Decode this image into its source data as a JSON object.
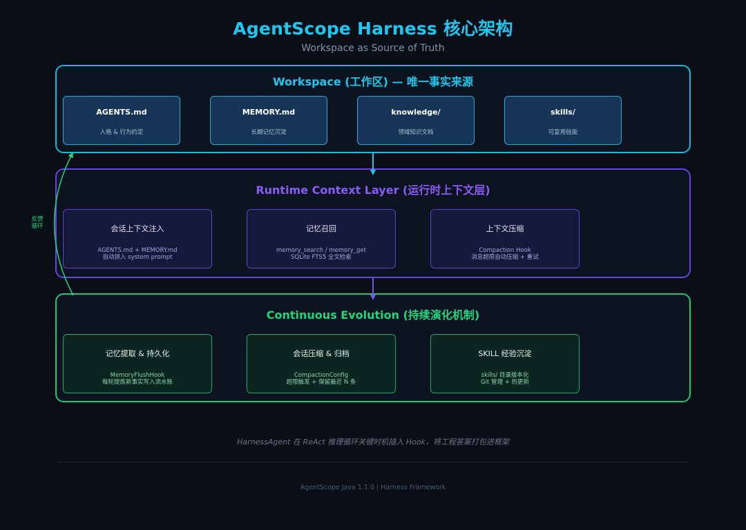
{
  "header": {
    "title": "AgentScope Harness 核心架构",
    "subtitle": "Workspace as Source of Truth"
  },
  "workspace": {
    "title": "Workspace (工作区) — 唯一事实来源",
    "cards": [
      {
        "title": "AGENTS.md",
        "desc": "人格 & 行为约定"
      },
      {
        "title": "MEMORY.md",
        "desc": "长期记忆沉淀"
      },
      {
        "title": "knowledge/",
        "desc": "领域知识文档"
      },
      {
        "title": "skills/",
        "desc": "可复用技能"
      }
    ]
  },
  "runtime": {
    "title": "Runtime Context Layer (运行时上下文层)",
    "cards": [
      {
        "title": "会话上下文注入",
        "desc1": "AGENTS.md + MEMORY.md",
        "desc2": "自动拼入 system prompt"
      },
      {
        "title": "记忆召回",
        "desc1": "memory_search / memory_get",
        "desc2": "SQLite FTS5 全文检索"
      },
      {
        "title": "上下文压缩",
        "desc1": "Compaction Hook",
        "desc2": "消息超限自动压缩 + 重试"
      }
    ]
  },
  "evolution": {
    "title": "Continuous Evolution (持续演化机制)",
    "cards": [
      {
        "title": "记忆提取 & 持久化",
        "desc1": "MemoryFlushHook",
        "desc2": "每轮提炼新事实写入流水账"
      },
      {
        "title": "会话压缩 & 归档",
        "desc1": "CompactionConfig",
        "desc2": "超限触发 + 保留最近 N 条"
      },
      {
        "title": "SKILL 经验沉淀",
        "desc1": "skills/ 目录版本化",
        "desc2": "Git 管理 + 热更新"
      }
    ]
  },
  "feedback_label": {
    "line1": "反馈",
    "line2": "循环"
  },
  "caption": "HarnessAgent 在 ReAct 推理循环关键时机插入 Hook，将工程答案打包进框架",
  "footer": "AgentScope Java 1.1.0  |  Harness Framework",
  "colors": {
    "background": "#0a0e17",
    "workspace_accent": "#1cb8dc",
    "runtime_accent": "#6a45dc",
    "evolution_accent": "#1fc777"
  }
}
